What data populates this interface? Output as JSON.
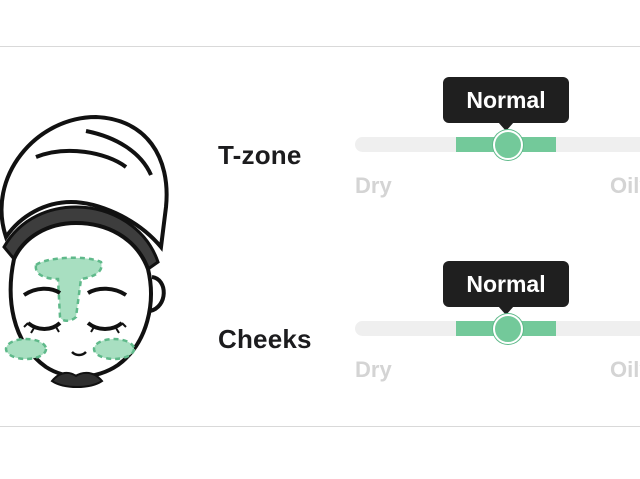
{
  "zones": [
    {
      "label": "T-zone",
      "value": "Normal",
      "min_label": "Dry",
      "max_label": "Oily"
    },
    {
      "label": "Cheeks",
      "value": "Normal",
      "min_label": "Dry",
      "max_label": "Oily"
    }
  ],
  "colors": {
    "accent": "#73c99a",
    "track": "#efefef",
    "tooltip": "#1f1f1f",
    "muted_text": "#d4d4d4"
  },
  "icons": {
    "illustration": "face-with-towel-icon"
  }
}
